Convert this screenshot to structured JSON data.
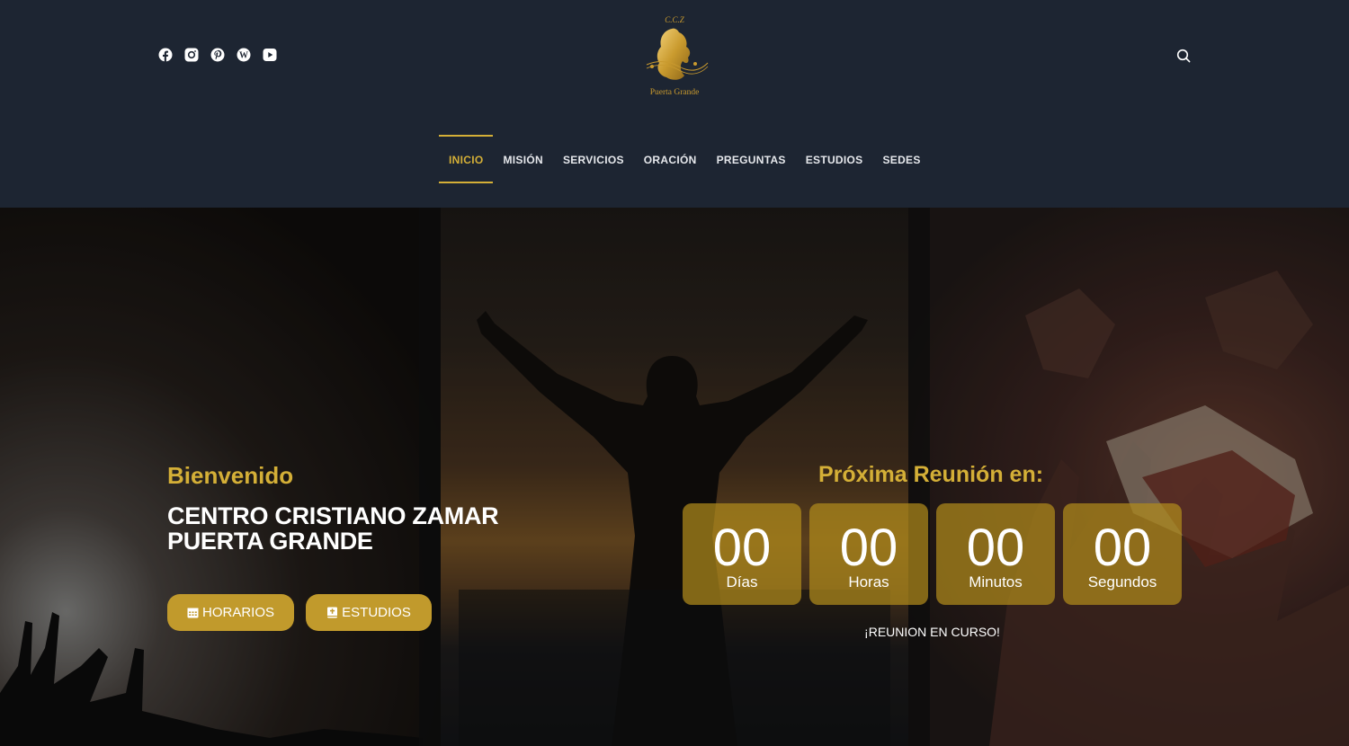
{
  "colors": {
    "header_bg": "#1d2532",
    "accent_gold": "#d4af37",
    "button_gold": "#c19a2c",
    "countdown_box": "#b08a1c",
    "text_white": "#ffffff"
  },
  "header": {
    "social_icons": [
      "facebook-icon",
      "instagram-icon",
      "pinterest-icon",
      "wordpress-icon",
      "youtube-icon"
    ],
    "logo": {
      "top_text": "C.C.Z",
      "bottom_text": "Puerta Grande"
    },
    "search_icon": "search-icon"
  },
  "nav": {
    "items": [
      {
        "label": "INICIO",
        "active": true
      },
      {
        "label": "MISIÓN",
        "active": false
      },
      {
        "label": "SERVICIOS",
        "active": false
      },
      {
        "label": "ORACIÓN",
        "active": false
      },
      {
        "label": "PREGUNTAS",
        "active": false
      },
      {
        "label": "ESTUDIOS",
        "active": false
      },
      {
        "label": "SEDES",
        "active": false
      }
    ]
  },
  "hero": {
    "welcome": "Bienvenido",
    "title_line1": "CENTRO CRISTIANO ZAMAR",
    "title_line2": "PUERTA GRANDE",
    "buttons": {
      "horarios": {
        "label": "HORARIOS",
        "icon": "calendar-icon"
      },
      "estudios": {
        "label": "ESTUDIOS",
        "icon": "bible-icon"
      }
    }
  },
  "countdown": {
    "title": "Próxima Reunión en:",
    "units": [
      {
        "value": "00",
        "label": "Días"
      },
      {
        "value": "00",
        "label": "Horas"
      },
      {
        "value": "00",
        "label": "Minutos"
      },
      {
        "value": "00",
        "label": "Segundos"
      }
    ],
    "status": "¡REUNION EN CURSO!"
  }
}
